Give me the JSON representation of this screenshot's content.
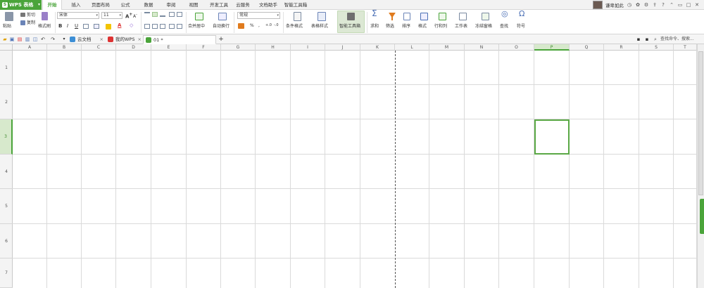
{
  "app": {
    "name": "WPS 表格"
  },
  "menu": {
    "tabs": [
      "开始",
      "插入",
      "页面布局",
      "公式",
      "数据",
      "审阅",
      "视图",
      "开发工具",
      "云服务",
      "文档助手",
      "智能工具箱"
    ],
    "active": "开始"
  },
  "user": {
    "name": "谦卑如此"
  },
  "ribbon": {
    "paste": "粘贴",
    "cut": "剪切",
    "copy": "复制",
    "format_painter": "格式刷",
    "font_name": "宋体",
    "font_size": "11",
    "bold": "B",
    "italic": "I",
    "underline": "U",
    "merge_center": "合并居中",
    "wrap_text": "自动换行",
    "number_format": "常规",
    "percent": "%",
    "comma": ",",
    "cond_format": "条件格式",
    "table_style": "表格样式",
    "smart_toolbox": "智能工具箱",
    "sum": "求和",
    "filter": "筛选",
    "sort": "排序",
    "format": "格式",
    "row_col": "行和列",
    "worksheet": "工作表",
    "freeze": "冻结窗格",
    "find": "查找",
    "symbol": "符号"
  },
  "doc_tabs": [
    {
      "label": "云文档"
    },
    {
      "label": "我的WPS"
    },
    {
      "label": "01 *"
    }
  ],
  "search": {
    "placeholder": "查找命令、搜索..."
  },
  "columns": [
    "A",
    "B",
    "C",
    "D",
    "E",
    "F",
    "G",
    "H",
    "I",
    "J",
    "K",
    "L",
    "M",
    "N",
    "O",
    "P",
    "Q",
    "R",
    "S",
    "T"
  ],
  "rows": [
    "1",
    "2",
    "3",
    "4",
    "5",
    "6",
    "7"
  ],
  "selected": {
    "column": "P",
    "row": "3"
  },
  "colors": {
    "accent": "#4aa43a",
    "selection": "#5aa845"
  }
}
